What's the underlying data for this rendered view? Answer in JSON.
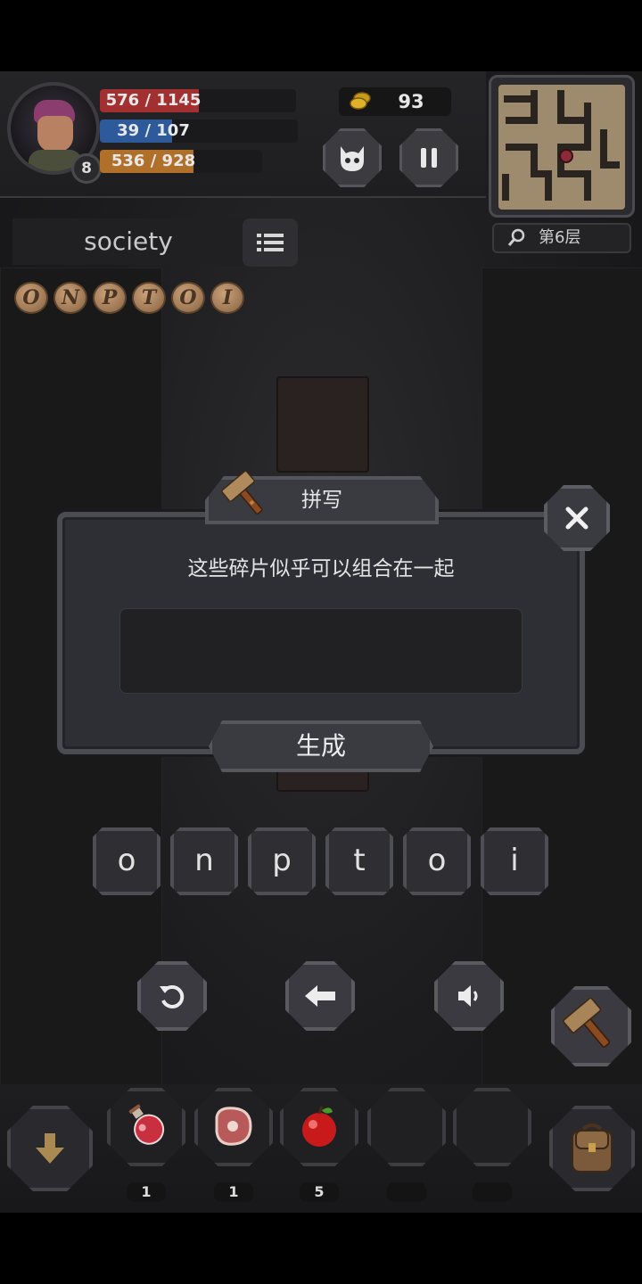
{
  "hud": {
    "level": "8",
    "hp": {
      "current": 576,
      "max": 1145,
      "text": "576 / 1145",
      "color": "#a23030"
    },
    "mp": {
      "current": 39,
      "max": 107,
      "text": "39 / 107",
      "color": "#2d5a9a"
    },
    "xp": {
      "current": 536,
      "max": 928,
      "text": "536 / 928",
      "color": "#b0702a"
    },
    "coins": "93",
    "floor": "第6层"
  },
  "quest": {
    "word": "society",
    "fragments": [
      "O",
      "N",
      "P",
      "T",
      "O",
      "I"
    ]
  },
  "dialog": {
    "title": "拼写",
    "message": "这些碎片似乎可以组合在一起",
    "input_value": "",
    "generate_label": "生成"
  },
  "letters": [
    "o",
    "n",
    "p",
    "t",
    "o",
    "i"
  ],
  "controls": {
    "icons": [
      "refresh-icon",
      "backspace-icon",
      "speaker-icon"
    ]
  },
  "inventory": [
    {
      "icon": "potion-icon",
      "count": "1"
    },
    {
      "icon": "meat-icon",
      "count": "1"
    },
    {
      "icon": "apple-icon",
      "count": "5"
    },
    {
      "icon": "",
      "count": ""
    },
    {
      "icon": "",
      "count": ""
    }
  ]
}
